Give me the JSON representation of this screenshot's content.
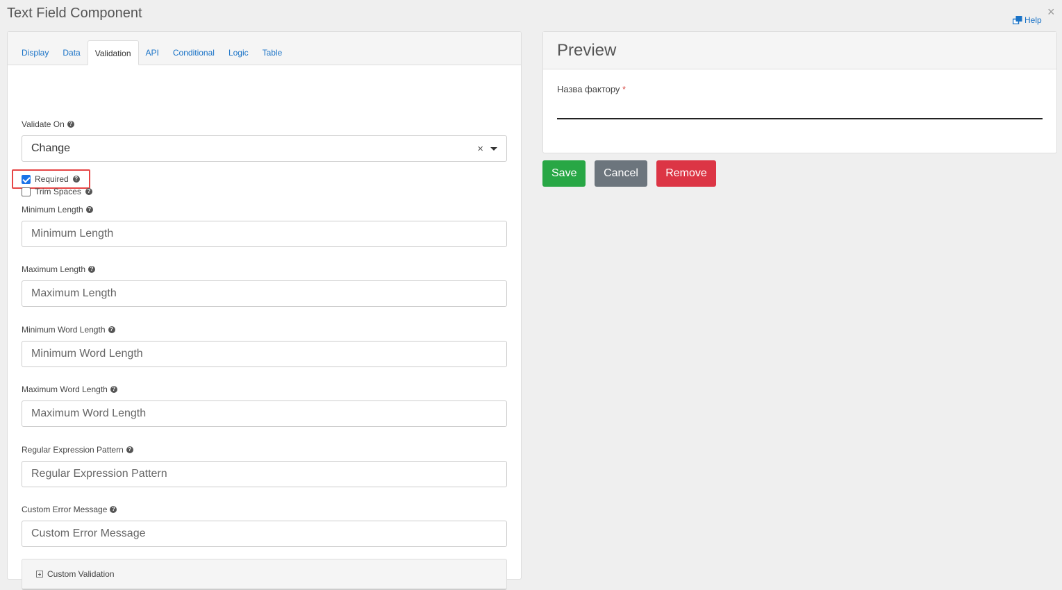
{
  "dialog": {
    "title": "Text Field Component",
    "help_label": "Help",
    "close_glyph": "×"
  },
  "tabs": [
    {
      "label": "Display",
      "active": false
    },
    {
      "label": "Data",
      "active": false
    },
    {
      "label": "Validation",
      "active": true
    },
    {
      "label": "API",
      "active": false
    },
    {
      "label": "Conditional",
      "active": false
    },
    {
      "label": "Logic",
      "active": false
    },
    {
      "label": "Table",
      "active": false
    }
  ],
  "validation": {
    "validate_on": {
      "label": "Validate On",
      "value": "Change",
      "clear_glyph": "×"
    },
    "required": {
      "label": "Required",
      "checked": true
    },
    "trim_spaces": {
      "label": "Trim Spaces",
      "checked": false
    },
    "min_length": {
      "label": "Minimum Length",
      "placeholder": "Minimum Length"
    },
    "max_length": {
      "label": "Maximum Length",
      "placeholder": "Maximum Length"
    },
    "min_word_length": {
      "label": "Minimum Word Length",
      "placeholder": "Minimum Word Length"
    },
    "max_word_length": {
      "label": "Maximum Word Length",
      "placeholder": "Maximum Word Length"
    },
    "regex_pattern": {
      "label": "Regular Expression Pattern",
      "placeholder": "Regular Expression Pattern"
    },
    "custom_error": {
      "label": "Custom Error Message",
      "placeholder": "Custom Error Message"
    },
    "custom_validation": {
      "label": "Custom Validation"
    }
  },
  "preview": {
    "title": "Preview",
    "field_label": "Назва фактору",
    "required_marker": "*"
  },
  "actions": {
    "save": "Save",
    "cancel": "Cancel",
    "remove": "Remove"
  },
  "colors": {
    "save": "#28a745",
    "cancel": "#6c757d",
    "remove": "#dc3545",
    "link": "#1a73c7",
    "highlight": "#e64545"
  },
  "icons": {
    "help": "external-window-icon",
    "tooltip": "question-circle-icon",
    "accordion": "plus-square-icon",
    "select": "caret-down-icon"
  }
}
